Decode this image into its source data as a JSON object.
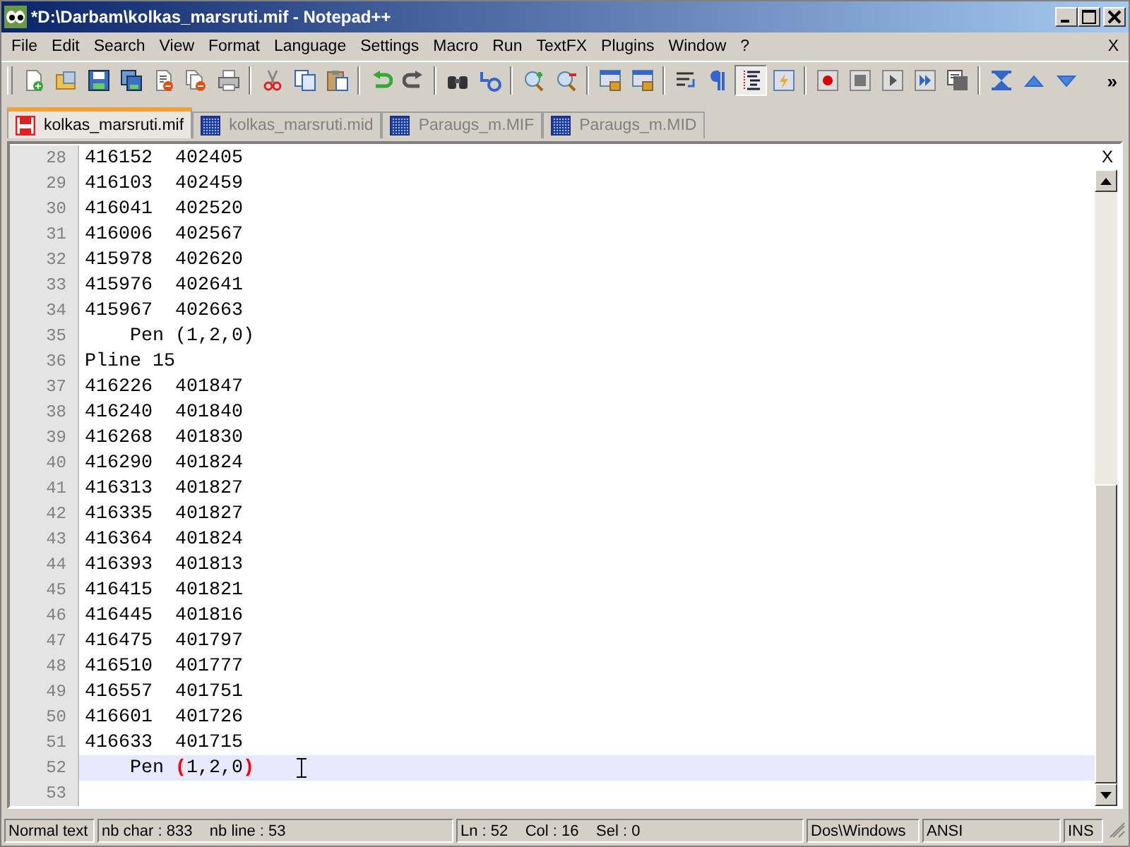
{
  "window": {
    "title": "*D:\\Darbam\\kolkas_marsruti.mif - Notepad++"
  },
  "menu": [
    "File",
    "Edit",
    "Search",
    "View",
    "Format",
    "Language",
    "Settings",
    "Macro",
    "Run",
    "TextFX",
    "Plugins",
    "Window",
    "?"
  ],
  "menu_close": "X",
  "toolbar": [
    {
      "kind": "new",
      "pressed": false
    },
    {
      "kind": "open",
      "pressed": false
    },
    {
      "kind": "save",
      "pressed": false
    },
    {
      "kind": "save-all",
      "pressed": false
    },
    {
      "kind": "close",
      "pressed": false
    },
    {
      "kind": "close-all",
      "pressed": false
    },
    {
      "kind": "print",
      "pressed": false
    },
    {
      "kind": "sep"
    },
    {
      "kind": "cut",
      "pressed": false
    },
    {
      "kind": "copy",
      "pressed": false
    },
    {
      "kind": "paste",
      "pressed": false
    },
    {
      "kind": "sep"
    },
    {
      "kind": "undo",
      "pressed": false
    },
    {
      "kind": "redo",
      "pressed": false
    },
    {
      "kind": "sep"
    },
    {
      "kind": "find",
      "pressed": false
    },
    {
      "kind": "replace",
      "pressed": false
    },
    {
      "kind": "sep"
    },
    {
      "kind": "zoom-in",
      "pressed": false
    },
    {
      "kind": "zoom-out",
      "pressed": false
    },
    {
      "kind": "sep"
    },
    {
      "kind": "lock-v",
      "pressed": false
    },
    {
      "kind": "lock-h",
      "pressed": false
    },
    {
      "kind": "sep"
    },
    {
      "kind": "wrap",
      "pressed": false
    },
    {
      "kind": "pilcrow",
      "pressed": false
    },
    {
      "kind": "indent",
      "pressed": true
    },
    {
      "kind": "lightning",
      "pressed": false
    },
    {
      "kind": "sep"
    },
    {
      "kind": "record",
      "pressed": false
    },
    {
      "kind": "stop",
      "pressed": false
    },
    {
      "kind": "play",
      "pressed": false
    },
    {
      "kind": "play-multi",
      "pressed": false
    },
    {
      "kind": "save-macro",
      "pressed": false
    },
    {
      "kind": "sep"
    },
    {
      "kind": "collapse",
      "pressed": false
    },
    {
      "kind": "up",
      "pressed": false
    },
    {
      "kind": "down",
      "pressed": false
    }
  ],
  "toolbar_more": "»",
  "tabs": [
    {
      "label": "kolkas_marsruti.mif",
      "selected": true,
      "modified": true
    },
    {
      "label": "kolkas_marsruti.mid",
      "selected": false,
      "modified": false
    },
    {
      "label": "Paraugs_m.MIF",
      "selected": false,
      "modified": false
    },
    {
      "label": "Paraugs_m.MID",
      "selected": false,
      "modified": false
    }
  ],
  "editor_close": "X",
  "lines": [
    {
      "number": "28",
      "text": "416152  402405",
      "current": false
    },
    {
      "number": "29",
      "text": "416103  402459",
      "current": false
    },
    {
      "number": "30",
      "text": "416041  402520",
      "current": false
    },
    {
      "number": "31",
      "text": "416006  402567",
      "current": false
    },
    {
      "number": "32",
      "text": "415978  402620",
      "current": false
    },
    {
      "number": "33",
      "text": "415976  402641",
      "current": false
    },
    {
      "number": "34",
      "text": "415967  402663",
      "current": false
    },
    {
      "number": "35",
      "text": "    Pen (1,2,0)",
      "current": false
    },
    {
      "number": "36",
      "text": "Pline 15",
      "current": false
    },
    {
      "number": "37",
      "text": "416226  401847",
      "current": false
    },
    {
      "number": "38",
      "text": "416240  401840",
      "current": false
    },
    {
      "number": "39",
      "text": "416268  401830",
      "current": false
    },
    {
      "number": "40",
      "text": "416290  401824",
      "current": false
    },
    {
      "number": "41",
      "text": "416313  401827",
      "current": false
    },
    {
      "number": "42",
      "text": "416335  401827",
      "current": false
    },
    {
      "number": "43",
      "text": "416364  401824",
      "current": false
    },
    {
      "number": "44",
      "text": "416393  401813",
      "current": false
    },
    {
      "number": "45",
      "text": "416415  401821",
      "current": false
    },
    {
      "number": "46",
      "text": "416445  401816",
      "current": false
    },
    {
      "number": "47",
      "text": "416475  401797",
      "current": false
    },
    {
      "number": "48",
      "text": "416510  401777",
      "current": false
    },
    {
      "number": "49",
      "text": "416557  401751",
      "current": false
    },
    {
      "number": "50",
      "text": "416601  401726",
      "current": false
    },
    {
      "number": "51",
      "text": "416633  401715",
      "current": false
    },
    {
      "number": "52",
      "segments": [
        {
          "text": "    Pen ",
          "kind": "plain"
        },
        {
          "text": "(",
          "kind": "brace"
        },
        {
          "text": "1,2,0",
          "kind": "plain"
        },
        {
          "text": ")",
          "kind": "brace"
        }
      ],
      "current": true
    },
    {
      "number": "53",
      "current": false
    }
  ],
  "status_bar": [
    "Normal text",
    "nb char : 833    nb line : 53",
    "Ln : 52    Col : 16    Sel : 0",
    "Dos\\Windows",
    "ANSI",
    "INS"
  ]
}
